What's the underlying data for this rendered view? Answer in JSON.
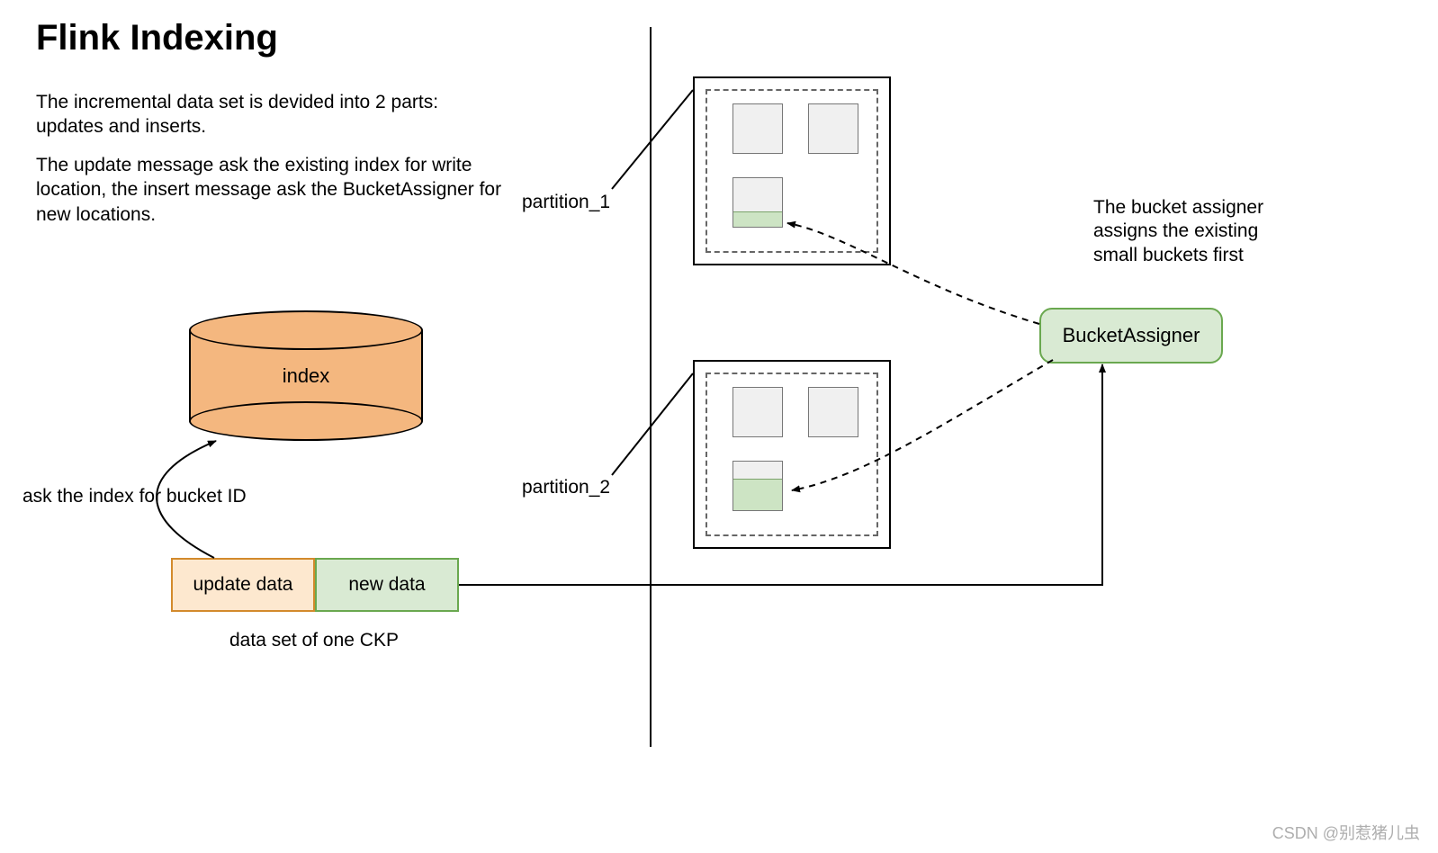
{
  "title": "Flink Indexing",
  "description": {
    "p1": "The incremental data set is devided into 2 parts: updates and inserts.",
    "p2": "The update message ask the existing index for write location, the insert message ask the BucketAssigner for new locations."
  },
  "index": {
    "label": "index",
    "note": "ask the index for bucket ID"
  },
  "data_set": {
    "update_label": "update data",
    "new_label": "new data",
    "caption": "data set of one CKP"
  },
  "partitions": {
    "p1_label": "partition_1",
    "p2_label": "partition_2"
  },
  "assigner": {
    "label": "BucketAssigner",
    "note": "The bucket assigner assigns the existing small buckets first"
  },
  "watermark": "CSDN @别惹猪儿虫"
}
